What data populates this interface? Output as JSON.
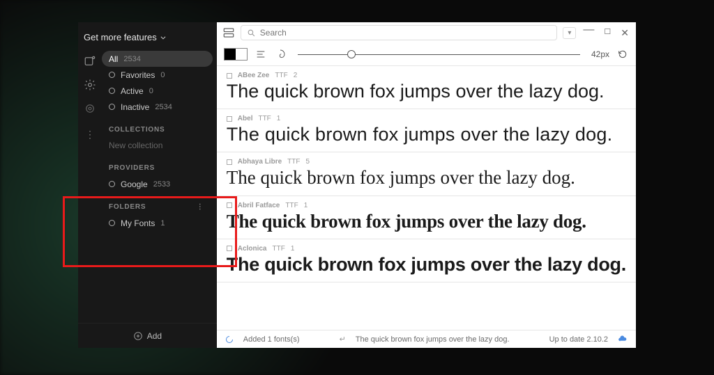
{
  "sidebar": {
    "get_more": "Get more features",
    "all": {
      "label": "All",
      "count": "2534"
    },
    "favorites": {
      "label": "Favorites",
      "count": "0"
    },
    "active": {
      "label": "Active",
      "count": "0"
    },
    "inactive": {
      "label": "Inactive",
      "count": "2534"
    },
    "sections": {
      "collections": "COLLECTIONS",
      "providers": "PROVIDERS",
      "folders": "FOLDERS"
    },
    "new_collection": "New collection",
    "providers": [
      {
        "label": "Google",
        "count": "2533"
      }
    ],
    "folders": [
      {
        "label": "My Fonts",
        "count": "1"
      }
    ],
    "add": "Add"
  },
  "toolbar": {
    "search_placeholder": "Search",
    "size_label": "42px"
  },
  "fonts": [
    {
      "name": "ABee Zee",
      "format": "TTF",
      "styles": "2",
      "preview": "The quick brown fox jumps over the lazy dog."
    },
    {
      "name": "Abel",
      "format": "TTF",
      "styles": "1",
      "preview": "The quick brown fox jumps over the lazy dog."
    },
    {
      "name": "Abhaya Libre",
      "format": "TTF",
      "styles": "5",
      "preview": "The quick brown fox jumps over the lazy dog."
    },
    {
      "name": "Abril Fatface",
      "format": "TTF",
      "styles": "1",
      "preview": "The quick brown fox jumps over the lazy dog."
    },
    {
      "name": "Aclonica",
      "format": "TTF",
      "styles": "1",
      "preview": "The quick brown fox jumps over the lazy dog."
    }
  ],
  "status": {
    "added": "Added 1 fonts(s)",
    "sample": "The quick brown fox jumps over the lazy dog.",
    "version": "Up to date 2.10.2"
  }
}
